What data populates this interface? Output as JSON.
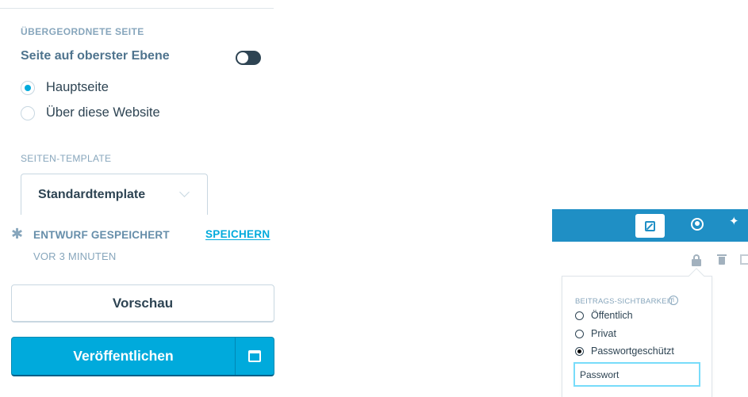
{
  "sidebar": {
    "parent_page": {
      "section_label": "ÜBERGEORDNETE SEITE",
      "toplevel_label": "Seite auf oberster Ebene",
      "toplevel_enabled": true,
      "options": [
        {
          "label": "Hauptseite",
          "selected": true
        },
        {
          "label": "Über diese Website",
          "selected": false
        }
      ]
    },
    "page_template": {
      "section_label": "SEITEN-TEMPLATE",
      "selected_value": "Standardtemplate"
    },
    "status": {
      "icon": "gear-icon",
      "draft_text": "ENTWURF GESPEICHERT",
      "save_link": "SPEICHERN",
      "time_text": "VOR 3 MINUTEN"
    },
    "actions": {
      "preview_label": "Vorschau",
      "publish_label": "Veröffentlichen",
      "schedule_icon": "calendar-icon"
    }
  },
  "editor_toolbar": {
    "icons": [
      "edit-icon",
      "avatar-icon",
      "pin-icon"
    ],
    "action_icons": [
      "lock-icon",
      "trash-icon",
      "external-link-icon"
    ],
    "accent_color": "#1f8fc5"
  },
  "visibility_popover": {
    "label": "BEITRAGS-SICHTBARKEIT",
    "options": [
      {
        "label": "Öffentlich",
        "selected": false
      },
      {
        "label": "Privat",
        "selected": false
      },
      {
        "label": "Passwortgeschützt",
        "selected": true
      }
    ],
    "password_value": "Passwort"
  },
  "colors": {
    "primary": "#00aadc",
    "text": "#2e4453",
    "muted": "#87a6bc"
  }
}
